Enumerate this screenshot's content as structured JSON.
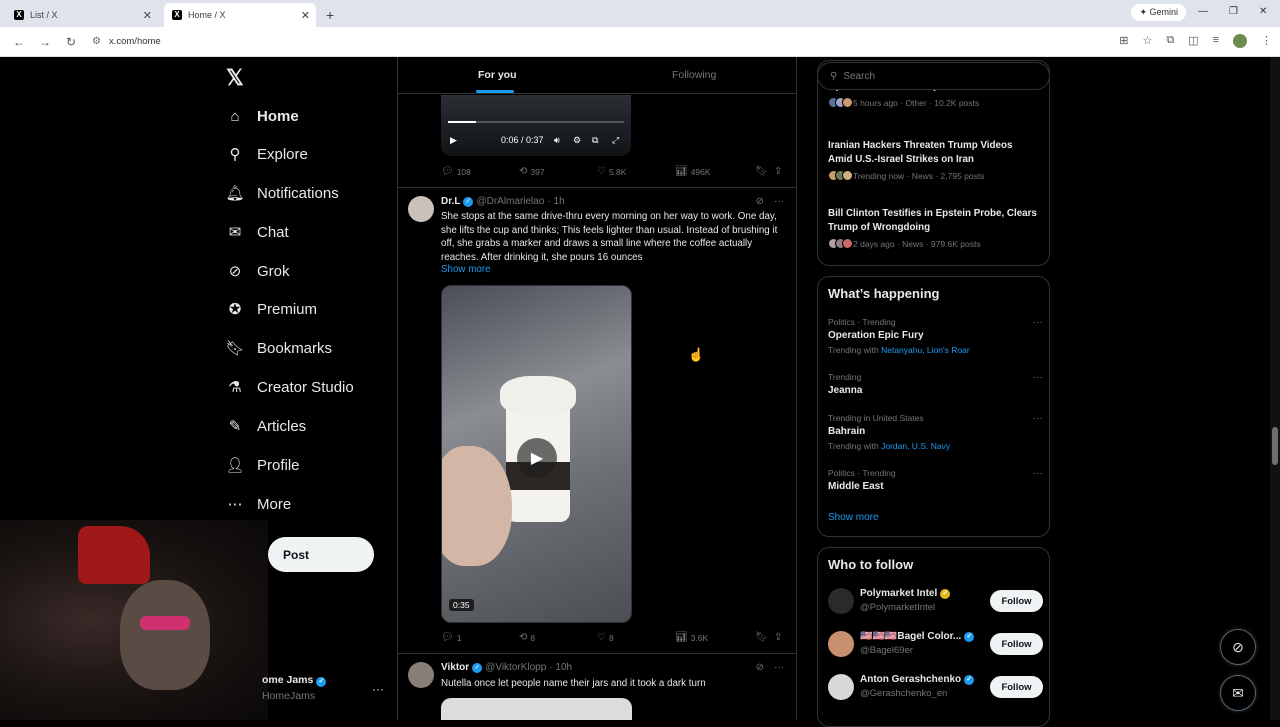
{
  "browser": {
    "tabs": [
      {
        "label": "List / X",
        "active": false
      },
      {
        "label": "Home / X",
        "active": true
      }
    ],
    "new_tab_icon": "+",
    "gemini_label": "Gemini",
    "url": "x.com/home"
  },
  "nav": {
    "items": [
      {
        "label": "Home",
        "icon": "home-icon",
        "glyph": "⌂",
        "active": true
      },
      {
        "label": "Explore",
        "icon": "search-icon",
        "glyph": "⚲"
      },
      {
        "label": "Notifications",
        "icon": "bell-icon",
        "glyph": "🔔︎"
      },
      {
        "label": "Chat",
        "icon": "mail-icon",
        "glyph": "✉"
      },
      {
        "label": "Grok",
        "icon": "grok-icon",
        "glyph": "⊘"
      },
      {
        "label": "Premium",
        "icon": "premium-icon",
        "glyph": "✪"
      },
      {
        "label": "Bookmarks",
        "icon": "bookmark-icon",
        "glyph": "🔖︎"
      },
      {
        "label": "Creator Studio",
        "icon": "flask-icon",
        "glyph": "⚗"
      },
      {
        "label": "Articles",
        "icon": "articles-icon",
        "glyph": "✎"
      },
      {
        "label": "Profile",
        "icon": "person-icon",
        "glyph": "👤︎"
      },
      {
        "label": "More",
        "icon": "more-circle-icon",
        "glyph": "⋯"
      }
    ],
    "post_label": "Post",
    "account": {
      "name": "ome Jams",
      "handle": "HomeJams"
    }
  },
  "feed": {
    "tabs": [
      {
        "label": "For you",
        "active": true
      },
      {
        "label": "Following",
        "active": false
      }
    ],
    "tweet1": {
      "video_time": "0:06 / 0:37",
      "video_progress": 0.16,
      "replies": "108",
      "reposts": "397",
      "likes": "5.8K",
      "views": "496K"
    },
    "tweet2": {
      "name": "Dr.L",
      "handle": "@DrAlmarielao",
      "time": "· 1h",
      "text": "She stops at the same drive-thru every morning on her way to work. One day, she lifts the cup and thinks; This feels lighter than usual. Instead of brushing it off, she grabs a marker and draws a small line where the coffee actually reaches. After drinking it, she pours 16 ounces",
      "show_more": "Show more",
      "duration": "0:35",
      "replies": "1",
      "reposts": "8",
      "likes": "8",
      "views": "3.6K"
    },
    "tweet3": {
      "name": "Viktor",
      "handle": "@ViktorKlopp",
      "time": "· 10h",
      "text": "Nutella once let people name their jars and it took a dark turn"
    }
  },
  "right": {
    "search_placeholder": "Search",
    "news": [
      {
        "title": "Opinions on Server Expectations",
        "meta": "5 hours ago · Other · 10.2K posts"
      },
      {
        "title": "Iranian Hackers Threaten Trump Videos Amid U.S.-Israel Strikes on Iran",
        "meta": "Trending now · News · 2,795 posts"
      },
      {
        "title": "Bill Clinton Testifies in Epstein Probe, Clears Trump of Wrongdoing",
        "meta": "2 days ago · News · 979.6K posts"
      }
    ],
    "whats_happening": {
      "title": "What’s happening",
      "trends": [
        {
          "context": "Politics · Trending",
          "name": "Operation Epic Fury",
          "with_prefix": "Trending with",
          "with": "Netanyahu, Lion's Roar"
        },
        {
          "context": "Trending",
          "name": "Jeanna",
          "with_prefix": "",
          "with": ""
        },
        {
          "context": "Trending in United States",
          "name": "Bahrain",
          "with_prefix": "Trending with",
          "with": "Jordan, U.S. Navy"
        },
        {
          "context": "Politics · Trending",
          "name": "Middle East",
          "with_prefix": "",
          "with": ""
        }
      ],
      "show_more": "Show more"
    },
    "who_to_follow": {
      "title": "Who to follow",
      "accounts": [
        {
          "name": "Polymarket Intel",
          "handle": "@PolymarketIntel",
          "badge": "gold"
        },
        {
          "name": "🇺🇸🇺🇸🇺🇸Bagel Color...",
          "handle": "@Bagel69er",
          "badge": "blue"
        },
        {
          "name": "Anton Gerashchenko",
          "handle": "@Gerashchenko_en",
          "badge": "blue"
        }
      ],
      "follow_label": "Follow"
    }
  }
}
